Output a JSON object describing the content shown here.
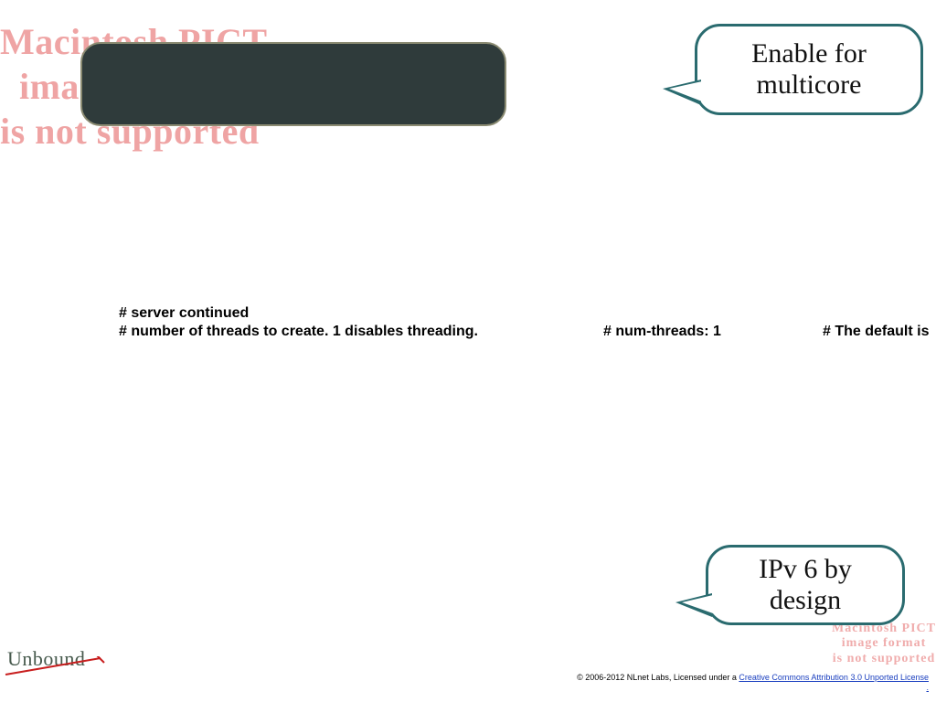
{
  "pict_placeholder": {
    "large": "Macintosh PICT\n  image format\nis not supported",
    "small": "Macintosh PICT\nimage format\nis not supported"
  },
  "callouts": {
    "top": "Enable for\nmulticore",
    "bottom": "IPv 6 by\ndesign"
  },
  "config": {
    "line1": "# server continued",
    "line2": "# number of threads to create. 1 disables threading.",
    "line3": "# num-threads: 1",
    "line4": "# The default is"
  },
  "branding": {
    "name": "Unbound"
  },
  "footer": {
    "pre": "© 2006-2012 NLnet Labs, Licensed under a ",
    "link": "Creative Commons Attribution 3.0 Unported License",
    "post": "."
  }
}
